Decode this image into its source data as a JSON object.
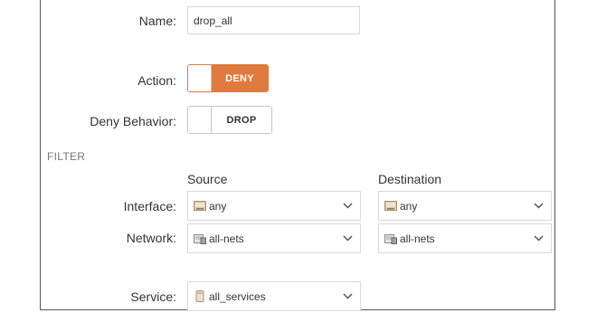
{
  "form": {
    "name_label": "Name:",
    "name_value": "drop_all",
    "action_label": "Action:",
    "action_value": "DENY",
    "deny_behavior_label": "Deny Behavior:",
    "deny_behavior_value": "DROP",
    "accent_color": "#e07a3e"
  },
  "filter": {
    "section_label": "FILTER",
    "source_header": "Source",
    "destination_header": "Destination",
    "interface_label": "Interface:",
    "network_label": "Network:",
    "service_label": "Service:",
    "source_interface": {
      "value": "any",
      "icon": "interface-icon"
    },
    "destination_interface": {
      "value": "any",
      "icon": "interface-icon"
    },
    "source_network": {
      "value": "all-nets",
      "icon": "network-object-icon"
    },
    "destination_network": {
      "value": "all-nets",
      "icon": "network-object-icon"
    },
    "service": {
      "value": "all_services",
      "icon": "service-object-icon"
    }
  }
}
